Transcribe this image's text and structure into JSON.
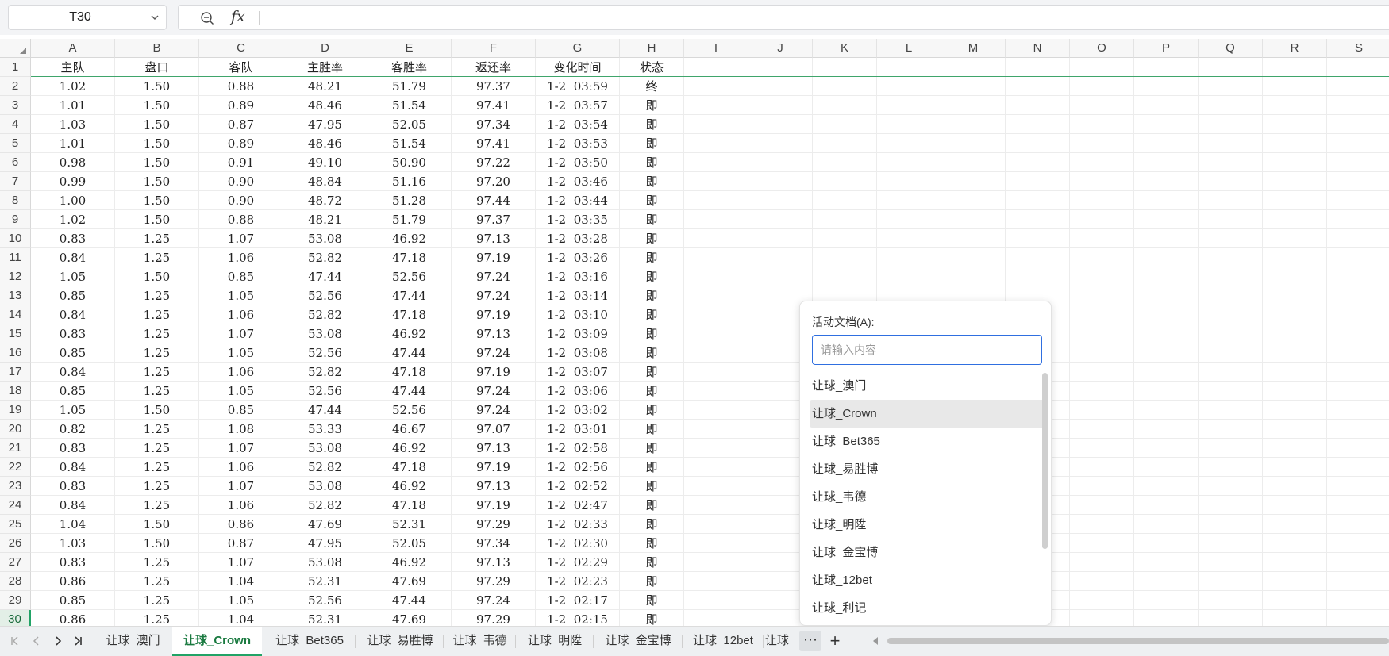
{
  "formula_bar": {
    "cell_reference": "T30",
    "formula": ""
  },
  "columns": [
    "A",
    "B",
    "C",
    "D",
    "E",
    "F",
    "G",
    "H",
    "I",
    "J",
    "K",
    "L",
    "M",
    "N",
    "O",
    "P",
    "Q",
    "R",
    "S"
  ],
  "table": {
    "headers": [
      "主队",
      "盘口",
      "客队",
      "主胜率",
      "客胜率",
      "返还率",
      "变化时间",
      "状态"
    ],
    "rows": [
      [
        "1.02",
        "1.50",
        "0.88",
        "48.21",
        "51.79",
        "97.37",
        "1-2  03:59",
        "终"
      ],
      [
        "1.01",
        "1.50",
        "0.89",
        "48.46",
        "51.54",
        "97.41",
        "1-2  03:57",
        "即"
      ],
      [
        "1.03",
        "1.50",
        "0.87",
        "47.95",
        "52.05",
        "97.34",
        "1-2  03:54",
        "即"
      ],
      [
        "1.01",
        "1.50",
        "0.89",
        "48.46",
        "51.54",
        "97.41",
        "1-2  03:53",
        "即"
      ],
      [
        "0.98",
        "1.50",
        "0.91",
        "49.10",
        "50.90",
        "97.22",
        "1-2  03:50",
        "即"
      ],
      [
        "0.99",
        "1.50",
        "0.90",
        "48.84",
        "51.16",
        "97.20",
        "1-2  03:46",
        "即"
      ],
      [
        "1.00",
        "1.50",
        "0.90",
        "48.72",
        "51.28",
        "97.44",
        "1-2  03:44",
        "即"
      ],
      [
        "1.02",
        "1.50",
        "0.88",
        "48.21",
        "51.79",
        "97.37",
        "1-2  03:35",
        "即"
      ],
      [
        "0.83",
        "1.25",
        "1.07",
        "53.08",
        "46.92",
        "97.13",
        "1-2  03:28",
        "即"
      ],
      [
        "0.84",
        "1.25",
        "1.06",
        "52.82",
        "47.18",
        "97.19",
        "1-2  03:26",
        "即"
      ],
      [
        "1.05",
        "1.50",
        "0.85",
        "47.44",
        "52.56",
        "97.24",
        "1-2  03:16",
        "即"
      ],
      [
        "0.85",
        "1.25",
        "1.05",
        "52.56",
        "47.44",
        "97.24",
        "1-2  03:14",
        "即"
      ],
      [
        "0.84",
        "1.25",
        "1.06",
        "52.82",
        "47.18",
        "97.19",
        "1-2  03:10",
        "即"
      ],
      [
        "0.83",
        "1.25",
        "1.07",
        "53.08",
        "46.92",
        "97.13",
        "1-2  03:09",
        "即"
      ],
      [
        "0.85",
        "1.25",
        "1.05",
        "52.56",
        "47.44",
        "97.24",
        "1-2  03:08",
        "即"
      ],
      [
        "0.84",
        "1.25",
        "1.06",
        "52.82",
        "47.18",
        "97.19",
        "1-2  03:07",
        "即"
      ],
      [
        "0.85",
        "1.25",
        "1.05",
        "52.56",
        "47.44",
        "97.24",
        "1-2  03:06",
        "即"
      ],
      [
        "1.05",
        "1.50",
        "0.85",
        "47.44",
        "52.56",
        "97.24",
        "1-2  03:02",
        "即"
      ],
      [
        "0.82",
        "1.25",
        "1.08",
        "53.33",
        "46.67",
        "97.07",
        "1-2  03:01",
        "即"
      ],
      [
        "0.83",
        "1.25",
        "1.07",
        "53.08",
        "46.92",
        "97.13",
        "1-2  02:58",
        "即"
      ],
      [
        "0.84",
        "1.25",
        "1.06",
        "52.82",
        "47.18",
        "97.19",
        "1-2  02:56",
        "即"
      ],
      [
        "0.83",
        "1.25",
        "1.07",
        "53.08",
        "46.92",
        "97.13",
        "1-2  02:52",
        "即"
      ],
      [
        "0.84",
        "1.25",
        "1.06",
        "52.82",
        "47.18",
        "97.19",
        "1-2  02:47",
        "即"
      ],
      [
        "1.04",
        "1.50",
        "0.86",
        "47.69",
        "52.31",
        "97.29",
        "1-2  02:33",
        "即"
      ],
      [
        "1.03",
        "1.50",
        "0.87",
        "47.95",
        "52.05",
        "97.34",
        "1-2  02:30",
        "即"
      ],
      [
        "0.83",
        "1.25",
        "1.07",
        "53.08",
        "46.92",
        "97.13",
        "1-2  02:29",
        "即"
      ],
      [
        "0.86",
        "1.25",
        "1.04",
        "52.31",
        "47.69",
        "97.29",
        "1-2  02:23",
        "即"
      ],
      [
        "0.85",
        "1.25",
        "1.05",
        "52.56",
        "47.44",
        "97.24",
        "1-2  02:17",
        "即"
      ],
      [
        "0.86",
        "1.25",
        "1.04",
        "52.31",
        "47.69",
        "97.29",
        "1-2  02:15",
        "即"
      ]
    ]
  },
  "active_row": 30,
  "popup": {
    "label": "活动文档(A):",
    "search_placeholder": "请输入内容",
    "items": [
      "让球_澳门",
      "让球_Crown",
      "让球_Bet365",
      "让球_易胜博",
      "让球_韦德",
      "让球_明陞",
      "让球_金宝博",
      "让球_12bet",
      "让球_利记"
    ],
    "selected_index": 1
  },
  "sheet_tabs": {
    "tabs": [
      "让球_澳门",
      "让球_Crown",
      "让球_Bet365",
      "让球_易胜博",
      "让球_韦德",
      "让球_明陞",
      "让球_金宝博",
      "让球_12bet",
      "让球_"
    ],
    "active_index": 1,
    "more_label": "⋯",
    "add_label": "+"
  },
  "colors": {
    "accent_green": "#21a366",
    "active_tab_text": "#1a7a40",
    "search_focus_border": "#2f6fe0"
  }
}
